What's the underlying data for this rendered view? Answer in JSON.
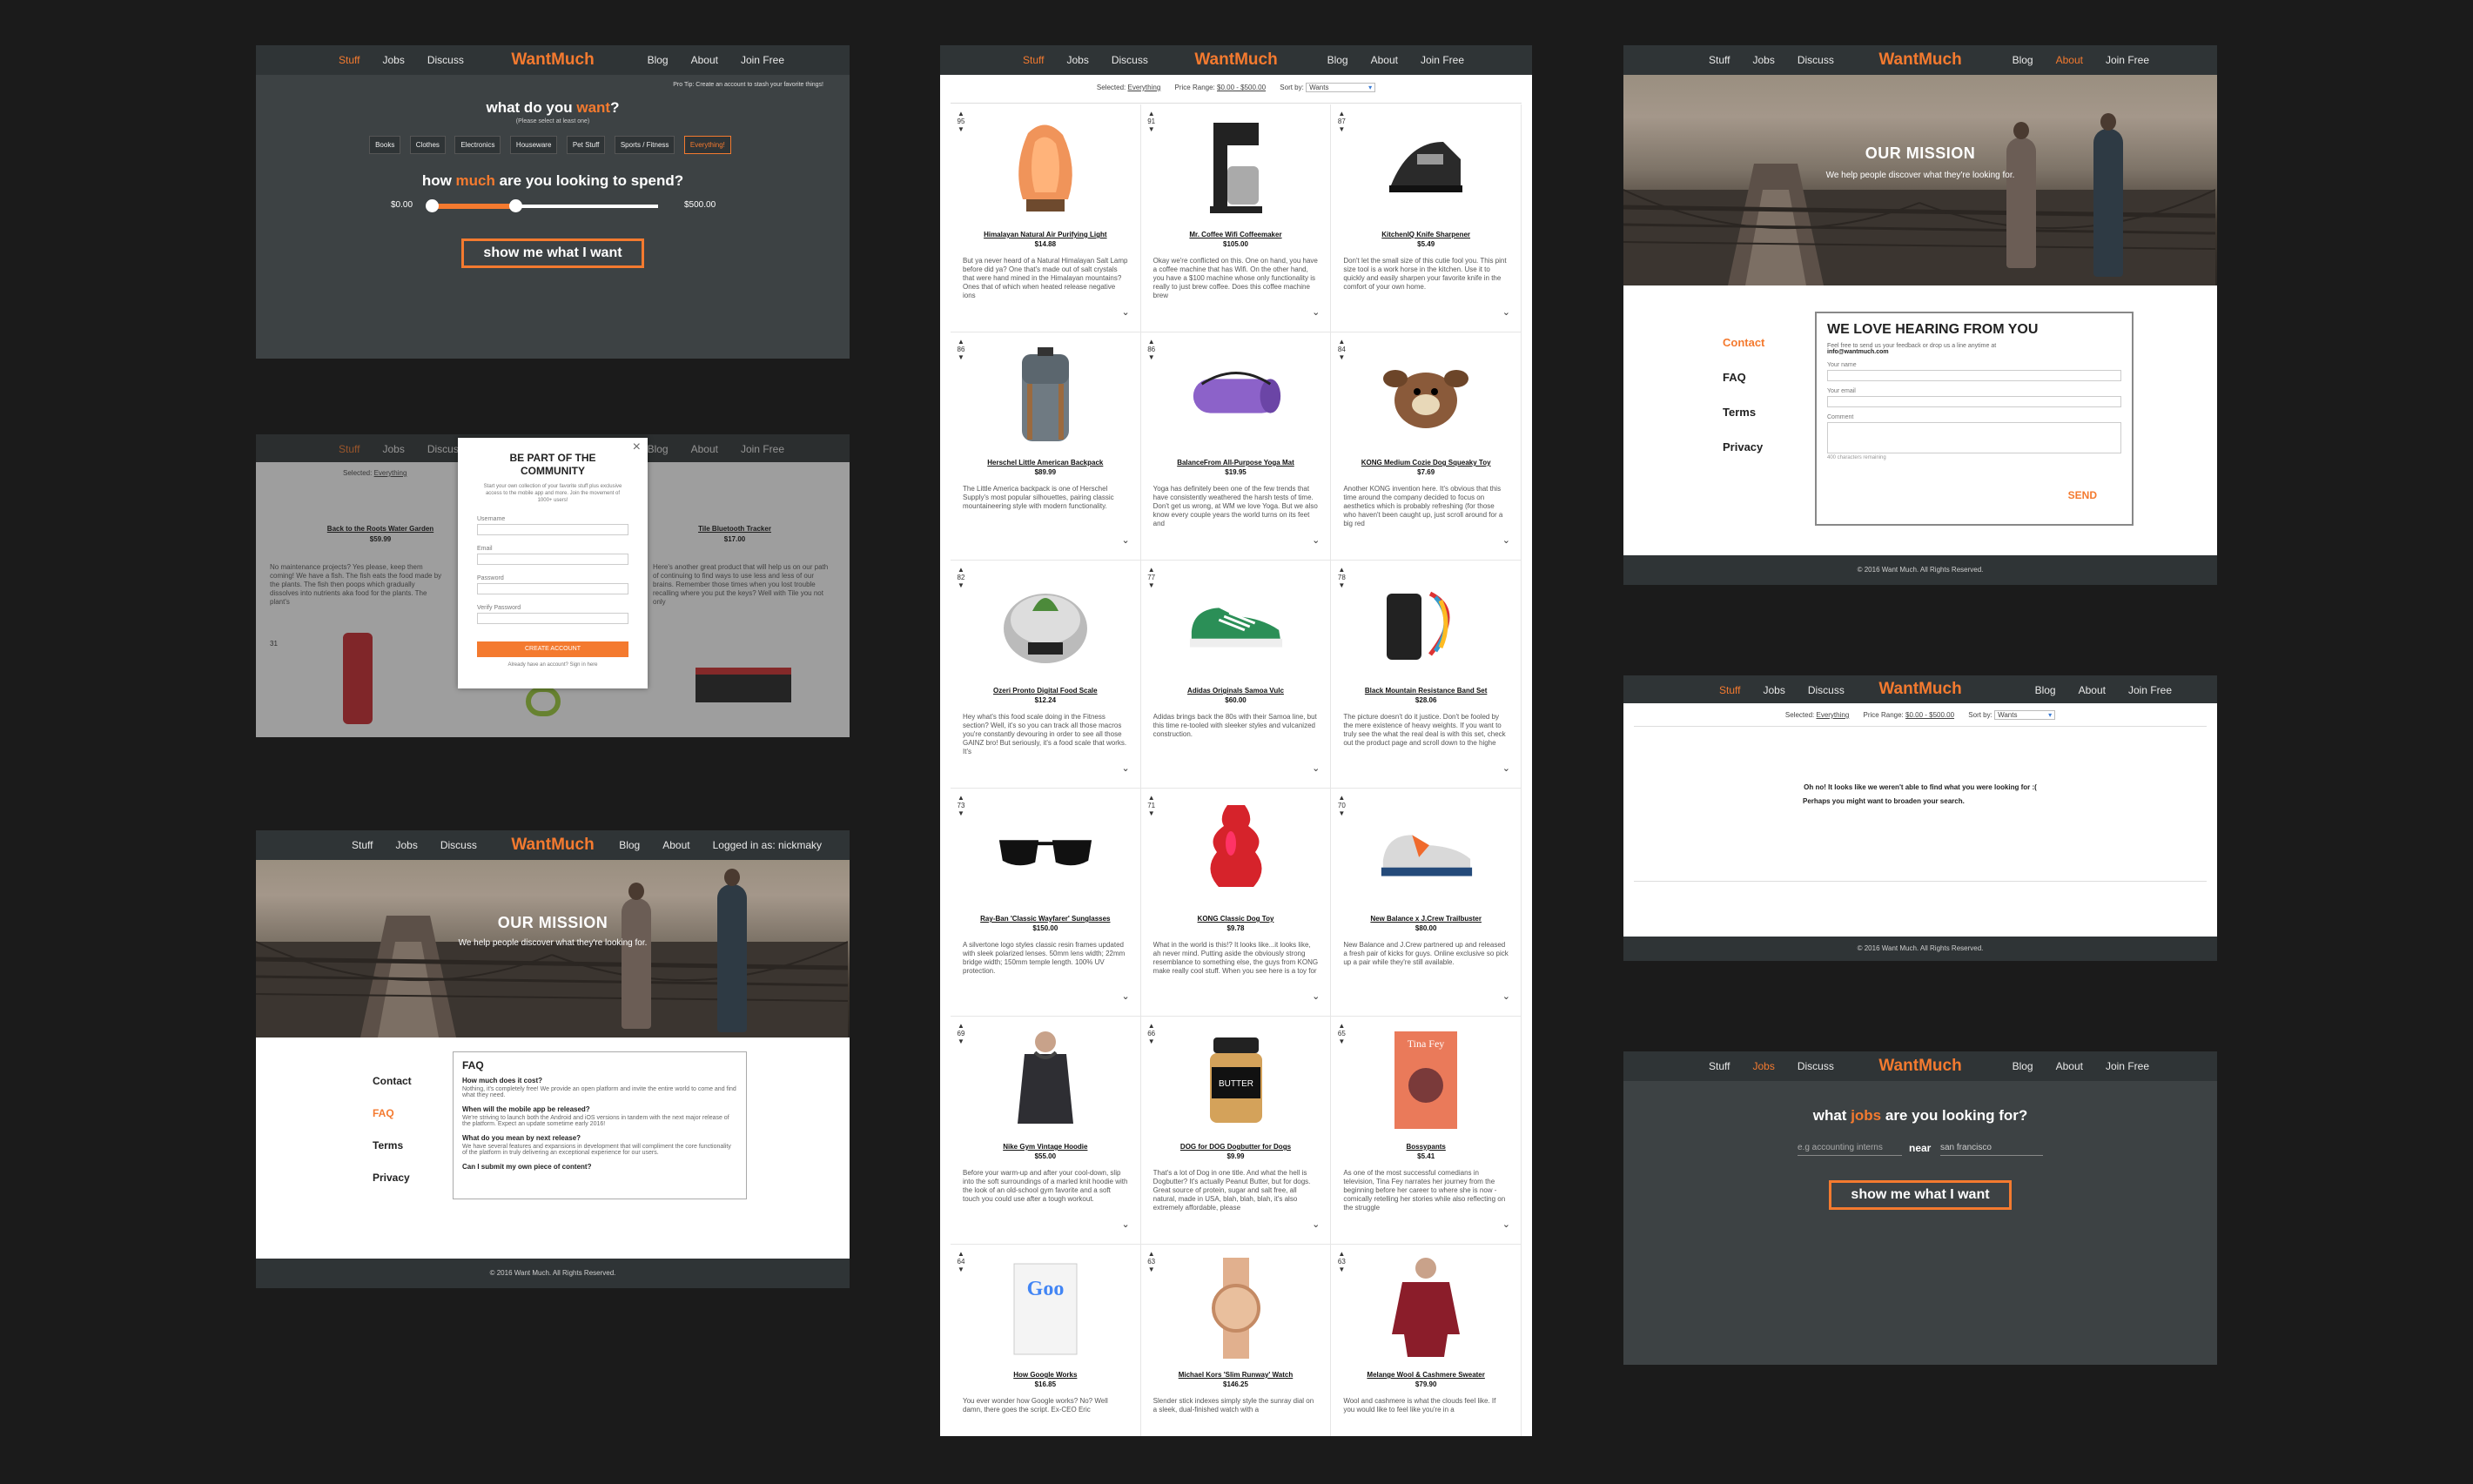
{
  "nav": {
    "stuff": "Stuff",
    "jobs": "Jobs",
    "discuss": "Discuss",
    "logo_want": "Want",
    "logo_much": "Much",
    "blog": "Blog",
    "about": "About",
    "join": "Join Free",
    "logged_in": "Logged in as: nickmaky"
  },
  "colors": {
    "accent": "#f47a2f",
    "dark": "#3a3e40",
    "navbar": "#2f3436",
    "background": "#1b1b1b"
  },
  "search": {
    "tip": "Pro Tip: Create an account to stash your favorite things!",
    "q1_pre": "what do you ",
    "q1_hl": "want",
    "q1_post": "?",
    "q1_sub": "(Please select at least one)",
    "categories": [
      "Books",
      "Clothes",
      "Electronics",
      "Houseware",
      "Pet Stuff",
      "Sports / Fitness",
      "Everything!"
    ],
    "q2_pre": "how ",
    "q2_hl": "much",
    "q2_post": " are you looking to spend?",
    "min_label": "$0.00",
    "max_label": "$500.00",
    "range_low": 0.0,
    "range_high": 0.37,
    "button": "show me what I want"
  },
  "filter": {
    "selected_label": "Selected:",
    "selected_value": "Everything",
    "price_label": "Price Range:",
    "price_value": "$0.00 - $500.00",
    "sort_label": "Sort by:",
    "sort_value": "Wants"
  },
  "modal": {
    "title": "BE PART OF THE COMMUNITY",
    "subtitle": "Start your own collection of your favorite stuff plus exclusive access to the mobile app and more. Join the movement of 1000+ users!",
    "fields": [
      "Username",
      "Email",
      "Password",
      "Verify Password"
    ],
    "button": "CREATE ACCOUNT",
    "footer": "Already have an account? Sign in here",
    "close": "×",
    "bg_products": [
      {
        "name": "Back to the Roots Water Garden",
        "price": "$59.99",
        "desc": "No maintenance projects? Yes please, keep them coming! We have a fish. The fish eats the food made by the plants. The fish then poops which gradually dissolves into nutrients aka food for the plants. The plant's"
      },
      {
        "name": "Tile Bluetooth Tracker",
        "price": "$17.00",
        "desc": "Here's another great product that will help us on our path of continuing to find ways to use less and less of our brains. Remember those times when you lost trouble recalling where you put the keys? Well with Tile you not only"
      }
    ],
    "bg_votes": [
      "31"
    ]
  },
  "mission": {
    "title": "OUR MISSION",
    "tagline": "We help people discover what they're looking for."
  },
  "faq_page": {
    "side": [
      "Contact",
      "FAQ",
      "Terms",
      "Privacy"
    ],
    "active": "FAQ",
    "box_title": "FAQ",
    "items": [
      {
        "q": "How much does it cost?",
        "a": "Nothing, it's completely free! We provide an open platform and invite the entire world to come and find what they need."
      },
      {
        "q": "When will the mobile app be released?",
        "a": "We're striving to launch both the Android and iOS versions in tandem with the next major release of the platform. Expect an update sometime early 2016!"
      },
      {
        "q": "What do you mean by next release?",
        "a": "We have several features and expansions in development that will compliment the core functionality of the platform in truly delivering an exceptional experience for our users."
      },
      {
        "q": "Can I submit my own piece of content?",
        "a": ""
      }
    ]
  },
  "contact_page": {
    "side": [
      "Contact",
      "FAQ",
      "Terms",
      "Privacy"
    ],
    "active": "Contact",
    "title": "WE LOVE HEARING FROM YOU",
    "intro": "Feel free to send us your feedback or drop us a line anytime at",
    "email": "info@wantmuch.com",
    "fields": [
      "Your name",
      "Your email",
      "Comment"
    ],
    "remaining": "400 characters remaining",
    "send": "SEND"
  },
  "empty_page": {
    "line1": "Oh no! It looks like we weren't able to find what you were looking for :(",
    "line2": "Perhaps you might want to broaden your search."
  },
  "jobs_page": {
    "q_pre": "what ",
    "q_hl": "jobs",
    "q_post": " are you looking for?",
    "what_placeholder": "e.g accounting interns",
    "near": "near",
    "where_value": "san francisco",
    "button": "show me what I want"
  },
  "footer": "© 2016 Want Much. All Rights Reserved.",
  "products": [
    {
      "votes": "95",
      "name": "Himalayan Natural Air Purifying Light",
      "price": "$14.88",
      "desc": "But ya never heard of a Natural Himalayan Salt Lamp before did ya? One that's made out of salt crystals that were hand mined in the Himalayan mountains? Ones that of which when heated release negative ions",
      "icon": "salt-lamp-icon"
    },
    {
      "votes": "91",
      "name": "Mr. Coffee Wifi Coffeemaker",
      "price": "$105.00",
      "desc": "Okay we're conflicted on this. One on hand, you have a coffee machine that has Wifi. On the other hand, you have a $100 machine whose only functionality is really to just brew coffee. Does this coffee machine brew",
      "icon": "coffee-maker-icon"
    },
    {
      "votes": "87",
      "name": "KitchenIQ Knife Sharpener",
      "price": "$5.49",
      "desc": "Don't let the small size of this cutie fool you. This pint size tool is a work horse in the kitchen. Use it to quickly and easily sharpen your favorite knife in the comfort of your own home.",
      "icon": "knife-sharpener-icon"
    },
    {
      "votes": "86",
      "name": "Herschel Little American Backpack",
      "price": "$89.99",
      "desc": "The Little America backpack is one of Herschel Supply's most popular silhouettes, pairing classic mountaineering style with modern functionality.",
      "icon": "backpack-icon"
    },
    {
      "votes": "86",
      "name": "BalanceFrom All-Purpose Yoga Mat",
      "price": "$19.95",
      "desc": "Yoga has definitely been one of the few trends that have consistently weathered the harsh tests of time. Don't get us wrong, at WM we love Yoga. But we also know every couple years the world turns on its feet and",
      "icon": "yoga-mat-icon"
    },
    {
      "votes": "84",
      "name": "KONG Medium Cozie Dog Squeaky Toy",
      "price": "$7.69",
      "desc": "Another KONG invention here. It's obvious that this time around the company decided to focus on aesthetics which is probably refreshing (for those who haven't been caught up, just scroll around for a big red",
      "icon": "plush-toy-icon"
    },
    {
      "votes": "82",
      "name": "Ozeri Pronto Digital Food Scale",
      "price": "$12.24",
      "desc": "Hey what's this food scale doing in the Fitness section? Well, it's so you can track all those macros you're constantly devouring in order to see all those GAINZ bro! But seriously, it's a food scale that works. It's",
      "icon": "food-scale-icon"
    },
    {
      "votes": "77",
      "name": "Adidas Originals Samoa Vulc",
      "price": "$60.00",
      "desc": "Adidas brings back the 80s with their Samoa line, but this time re-tooled with sleeker styles and vulcanized construction.",
      "icon": "sneaker-icon"
    },
    {
      "votes": "78",
      "name": "Black Mountain Resistance Band Set",
      "price": "$28.06",
      "desc": "The picture doesn't do it justice. Don't be fooled by the mere existence of heavy weights. If you want to truly see the what the real deal is with this set, check out the product page and scroll down to the highe",
      "icon": "resistance-band-icon"
    },
    {
      "votes": "73",
      "name": "Ray-Ban 'Classic Wayfarer' Sunglasses",
      "price": "$150.00",
      "desc": "A silvertone logo styles classic resin frames updated with sleek polarized lenses. 50mm lens width; 22mm bridge width; 150mm temple length. 100% UV protection.",
      "icon": "sunglasses-icon"
    },
    {
      "votes": "71",
      "name": "KONG Classic Dog Toy",
      "price": "$9.78",
      "desc": "What in the world is this!? It looks like...it looks like, ah never mind. Putting aside the obviously strong resemblance to something else, the guys from KONG make really cool stuff. When you see here is a toy for",
      "icon": "dog-toy-icon"
    },
    {
      "votes": "70",
      "name": "New Balance x J.Crew Trailbuster",
      "price": "$80.00",
      "desc": "New Balance and J.Crew partnered up and released a fresh pair of kicks for guys. Online exclusive so pick up a pair while they're still available.",
      "icon": "running-shoe-icon"
    },
    {
      "votes": "69",
      "name": "Nike Gym Vintage Hoodie",
      "price": "$55.00",
      "desc": "Before your warm-up and after your cool-down, slip into the soft surroundings of a marled knit hoodie with the look of an old-school gym favorite and a soft touch you could use after a tough workout.",
      "icon": "hoodie-icon"
    },
    {
      "votes": "66",
      "name": "DOG for DOG Dogbutter for Dogs",
      "price": "$9.99",
      "desc": "That's a lot of Dog in one title. And what the hell is Dogbutter? It's actually Peanut Butter, but for dogs. Great source of protein, sugar and salt free, all natural, made in USA, blah, blah, blah, it's also extremely affordable, please",
      "icon": "peanut-butter-jar-icon"
    },
    {
      "votes": "65",
      "name": "Bossypants",
      "price": "$5.41",
      "desc": "As one of the most successful comedians in television, Tina Fey narrates her journey from the beginning before her career to where she is now - comically retelling her stories while also reflecting on the struggle",
      "icon": "book-cover-icon"
    },
    {
      "votes": "64",
      "name": "How Google Works",
      "price": "$16.85",
      "desc": "You ever wonder how Google works? No? Well damn, there goes the script. Ex-CEO Eric",
      "icon": "google-book-icon"
    },
    {
      "votes": "63",
      "name": "Michael Kors 'Slim Runway' Watch",
      "price": "$146.25",
      "desc": "Slender stick indexes simply style the sunray dial on a sleek, dual-finished watch with a",
      "icon": "watch-icon"
    },
    {
      "votes": "63",
      "name": "Melange Wool & Cashmere Sweater",
      "price": "$79.90",
      "desc": "Wool and cashmere is what the clouds feel like. If you would like to feel like you're in a",
      "icon": "sweater-icon"
    }
  ]
}
